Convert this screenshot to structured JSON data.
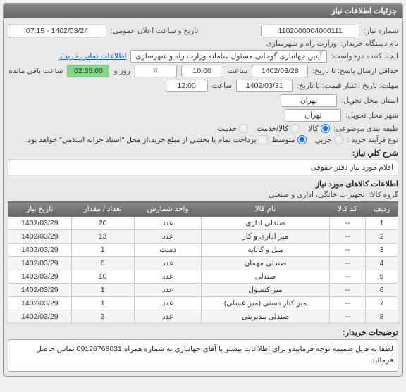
{
  "panel_title": "جزئیات اطلاعات نیاز",
  "fields": {
    "need_no_label": "شماره نیاز:",
    "need_no": "1102000004000111",
    "announce_label": "تاریخ و ساعت اعلان عمومی:",
    "announce_value": "1402/03/24 - 07:15",
    "buyer_label": "نام دستگاه خریدار:",
    "buyer_value": "وزارت راه و شهرسازی",
    "requester_label": "ایجاد کننده درخواست:",
    "requester_value": "آیتین جهانبازی گوجانی مسئول سامانه وزارت راه و شهرسازی",
    "contact_link": "اطلاعات تماس خریدار",
    "deadline_label": "حداقل ارسال پاسخ: تا تاریخ:",
    "deadline_date": "1402/03/28",
    "time_label": "ساعت",
    "deadline_time": "10:00",
    "day_label": "روز و",
    "remain_days": "4",
    "remain_time": "02:35:00",
    "remain_label": "ساعت باقی مانده",
    "valid_label": "مهلت: تاریخ اعتبار قیمت: تا تاریخ:",
    "valid_date": "1402/03/31",
    "valid_time": "12:00",
    "province_label": "استان محل تحویل:",
    "province_value": "تهران",
    "city_label": "شهر محل تحویل:",
    "city_value": "تهران",
    "subject_cat_label": "طبقه بندی موضوعی:",
    "cat_goods": "کالا",
    "cat_service": "کالا/خدمت",
    "cat_serv_only": "خدمت",
    "buy_type_label": "نوع فرآیند خرید :",
    "bt_small": "جزیی",
    "bt_medium": "متوسط",
    "bt_note": "پرداخت تمام یا بخشی از مبلغ خرید،از محل \"اسناد خزانه اسلامی\" خواهد بود."
  },
  "desc": {
    "title": "شرح کلي نياز:",
    "text": "اقلام مورد نیاز دفتر حقوقی"
  },
  "goods": {
    "title": "اطلاعات کالاهای مورد نیاز",
    "group_label": "گروه کالا:",
    "group_value": "تجهیزات خانگی، اداری و صنعتی"
  },
  "table": {
    "headers": [
      "ردیف",
      "کد کالا",
      "نام کالا",
      "واحد شمارش",
      "تعداد / مقدار",
      "تاریخ نیاز"
    ],
    "rows": [
      [
        "1",
        "--",
        "صندلی اداری",
        "عدد",
        "20",
        "1402/03/29"
      ],
      [
        "2",
        "--",
        "میز اداری و کار",
        "عدد",
        "13",
        "1402/03/29"
      ],
      [
        "3",
        "--",
        "مبل و کاناپه",
        "دست",
        "1",
        "1402/03/29"
      ],
      [
        "4",
        "--",
        "صندلی مهمان",
        "عدد",
        "6",
        "1402/03/29"
      ],
      [
        "5",
        "--",
        "صندلی",
        "عدد",
        "10",
        "1402/03/29"
      ],
      [
        "6",
        "--",
        "میز کنسول",
        "عدد",
        "1",
        "1402/03/29"
      ],
      [
        "7",
        "--",
        "میز کنار دستی (میز عسلی)",
        "عدد",
        "1",
        "1402/03/29"
      ],
      [
        "8",
        "--",
        "صندلی مدیریتی",
        "عدد",
        "3",
        "1402/03/29"
      ]
    ]
  },
  "footer": {
    "title": "توضیحات خریدار:",
    "text": "لطفا به فایل ضمیمه توجه فرماییدو برای اطلاعات بیشتر با  آقای جهانبازی به شماره همراه 09126768031 تماس حاصل فرمائید"
  },
  "chart_data": {
    "type": "table",
    "title": "اطلاعات کالاهای مورد نیاز",
    "columns": [
      "ردیف",
      "کد کالا",
      "نام کالا",
      "واحد شمارش",
      "تعداد / مقدار",
      "تاریخ نیاز"
    ],
    "rows": [
      {
        "row": 1,
        "code": "--",
        "name": "صندلی اداری",
        "unit": "عدد",
        "qty": 20,
        "date": "1402/03/29"
      },
      {
        "row": 2,
        "code": "--",
        "name": "میز اداری و کار",
        "unit": "عدد",
        "qty": 13,
        "date": "1402/03/29"
      },
      {
        "row": 3,
        "code": "--",
        "name": "مبل و کاناپه",
        "unit": "دست",
        "qty": 1,
        "date": "1402/03/29"
      },
      {
        "row": 4,
        "code": "--",
        "name": "صندلی مهمان",
        "unit": "عدد",
        "qty": 6,
        "date": "1402/03/29"
      },
      {
        "row": 5,
        "code": "--",
        "name": "صندلی",
        "unit": "عدد",
        "qty": 10,
        "date": "1402/03/29"
      },
      {
        "row": 6,
        "code": "--",
        "name": "میز کنسول",
        "unit": "عدد",
        "qty": 1,
        "date": "1402/03/29"
      },
      {
        "row": 7,
        "code": "--",
        "name": "میز کنار دستی (میز عسلی)",
        "unit": "عدد",
        "qty": 1,
        "date": "1402/03/29"
      },
      {
        "row": 8,
        "code": "--",
        "name": "صندلی مدیریتی",
        "unit": "عدد",
        "qty": 3,
        "date": "1402/03/29"
      }
    ]
  }
}
